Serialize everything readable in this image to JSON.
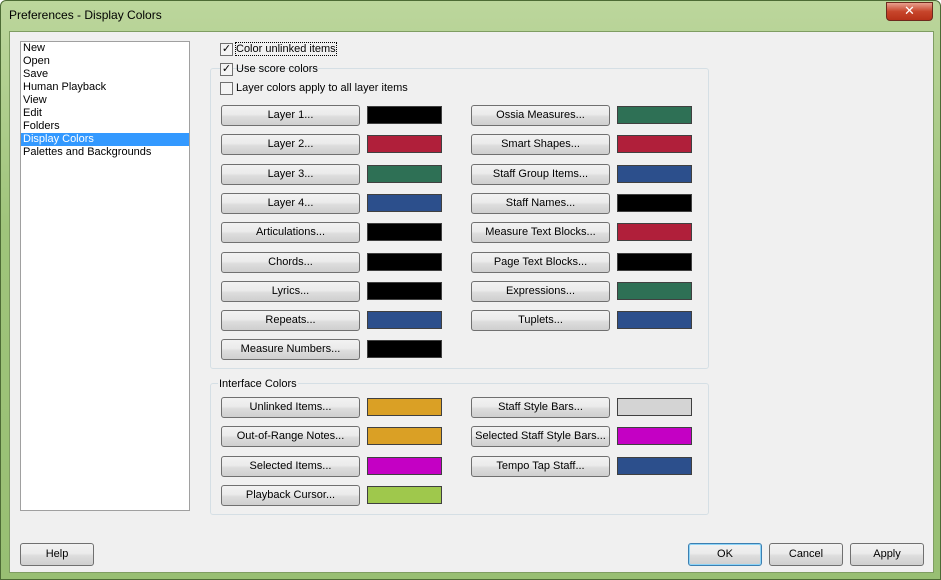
{
  "window": {
    "title": "Preferences - Display Colors",
    "close_label": "✕"
  },
  "nav": {
    "items": [
      {
        "label": "New",
        "selected": false
      },
      {
        "label": "Open",
        "selected": false
      },
      {
        "label": "Save",
        "selected": false
      },
      {
        "label": "Human Playback",
        "selected": false
      },
      {
        "label": "View",
        "selected": false
      },
      {
        "label": "Edit",
        "selected": false
      },
      {
        "label": "Folders",
        "selected": false
      },
      {
        "label": "Display Colors",
        "selected": true
      },
      {
        "label": "Palettes and Backgrounds",
        "selected": false
      }
    ]
  },
  "options": {
    "color_unlinked": {
      "label": "Color unlinked items",
      "checked": true,
      "mark": "✓"
    },
    "use_score_colors": {
      "label": "Use score colors",
      "checked": true,
      "mark": "✓"
    },
    "layer_all": {
      "label": "Layer colors apply to all layer items",
      "checked": false,
      "mark": ""
    }
  },
  "score_colors": {
    "left": [
      {
        "label": "Layer 1...",
        "color": "#000000"
      },
      {
        "label": "Layer 2...",
        "color": "#b01f3a"
      },
      {
        "label": "Layer 3...",
        "color": "#2e7055"
      },
      {
        "label": "Layer 4...",
        "color": "#2c4f8c"
      },
      {
        "label": "Articulations...",
        "color": "#000000"
      },
      {
        "label": "Chords...",
        "color": "#000000"
      },
      {
        "label": "Lyrics...",
        "color": "#000000"
      },
      {
        "label": "Repeats...",
        "color": "#2c4f8c"
      },
      {
        "label": "Measure Numbers...",
        "color": "#000000"
      }
    ],
    "right": [
      {
        "label": "Ossia Measures...",
        "color": "#2e7055"
      },
      {
        "label": "Smart Shapes...",
        "color": "#b01f3a"
      },
      {
        "label": "Staff Group Items...",
        "color": "#2c4f8c"
      },
      {
        "label": "Staff Names...",
        "color": "#000000"
      },
      {
        "label": "Measure Text Blocks...",
        "color": "#b01f3a"
      },
      {
        "label": "Page Text Blocks...",
        "color": "#000000"
      },
      {
        "label": "Expressions...",
        "color": "#2e7055"
      },
      {
        "label": "Tuplets...",
        "color": "#2c4f8c"
      }
    ]
  },
  "interface_colors": {
    "title": "Interface Colors",
    "left": [
      {
        "label": "Unlinked Items...",
        "color": "#daa025"
      },
      {
        "label": "Out-of-Range Notes...",
        "color": "#daa025"
      },
      {
        "label": "Selected Items...",
        "color": "#c400c4"
      },
      {
        "label": "Playback Cursor...",
        "color": "#9fc84c"
      }
    ],
    "right": [
      {
        "label": "Staff Style Bars...",
        "color": "#d4d4d4"
      },
      {
        "label": "Selected Staff Style Bars...",
        "color": "#c400c4"
      },
      {
        "label": "Tempo Tap Staff...",
        "color": "#2c4f8c"
      }
    ]
  },
  "footer": {
    "help": "Help",
    "ok": "OK",
    "cancel": "Cancel",
    "apply": "Apply"
  }
}
